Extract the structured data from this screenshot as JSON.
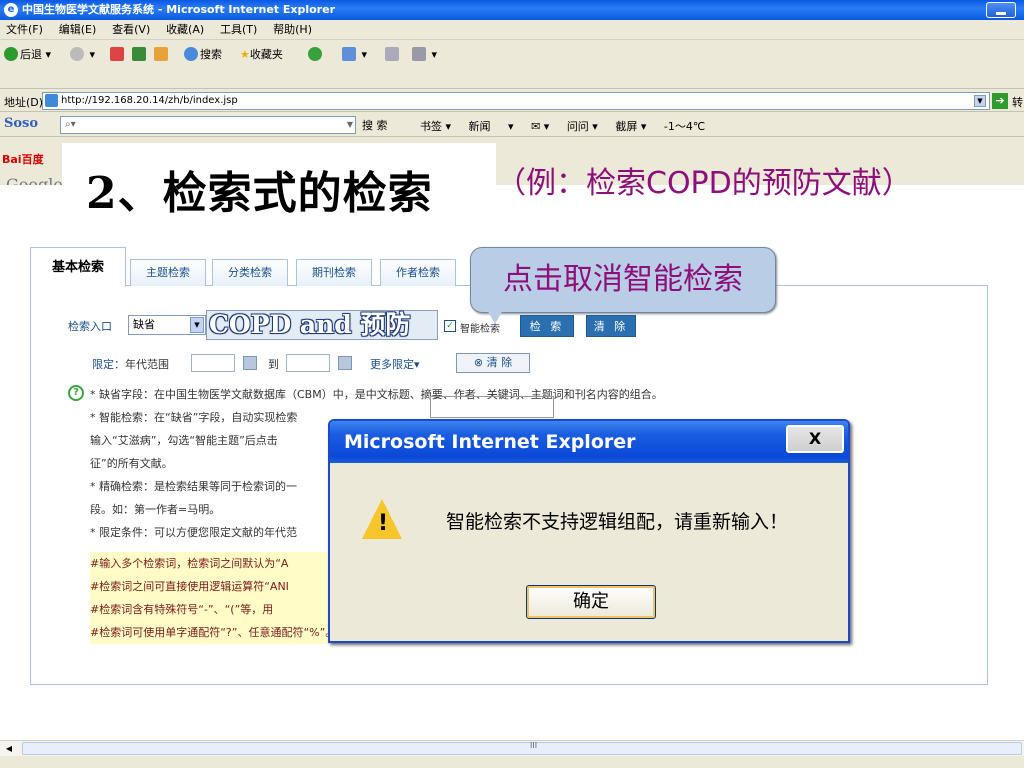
{
  "window": {
    "title": "中国生物医学文献服务系统 - Microsoft Internet Explorer"
  },
  "menu": [
    "文件(F)",
    "编辑(E)",
    "查看(V)",
    "收藏(A)",
    "工具(T)",
    "帮助(H)"
  ],
  "toolbar": {
    "back": "后退",
    "search": "搜索",
    "favorites": "收藏夹"
  },
  "address": {
    "label": "地址(D)",
    "url": "http://192.168.20.14/zh/b/index.jsp",
    "go": "转"
  },
  "soso": {
    "logo": "Soso",
    "search_btn": "搜 索",
    "items": [
      "书签 ▾",
      "新闻",
      "▾",
      "✉ ▾",
      "问问 ▾",
      "截屏 ▾",
      "-1～4℃"
    ]
  },
  "side": {
    "baidu": "Bai百度",
    "google": "Google"
  },
  "slide": {
    "heading": "2、检索式的检索",
    "example": "（例：检索COPD的预防文献）",
    "callout": "点击取消智能检索"
  },
  "tabs": [
    "基本检索",
    "主题检索",
    "分类检索",
    "期刊检索",
    "作者检索"
  ],
  "form": {
    "entry_label": "检索入口",
    "entry_value": "缺省",
    "query": "COPD and 预防",
    "smart_label": "智能检索",
    "smart_checked": "✓",
    "search_btn": "检 索",
    "clear_btn": "清 除",
    "limit_label": "限定：",
    "year_range": "年代范围",
    "to": "到",
    "more_limits": "更多限定▾",
    "clear_limits": "⊗ 清 除"
  },
  "help": {
    "icon": "?",
    "lines": [
      "* 缺省字段：在中国生物医学文献数据库（CBM）中，是中文标题、摘要、作者、关键词、主题词和刊名内容的组合。",
      "* 智能检索：在“缺省”字段，自动实现检索",
      "输入“艾滋病”，勾选“智能主题”后点击",
      "征”的所有文献。",
      "* 精确检索：是检索结果等同于检索词的一",
      "段。如：第一作者=马明。",
      "* 限定条件：可以方便您限定文献的年代范"
    ],
    "tips": [
      "#输入多个检索词，检索词之间默认为“A",
      "#检索词之间可直接使用逻辑运算符“ANI",
      "#检索词含有特殊符号“-”、“(”等，用",
      "#检索词可使用单字通配符“?”、任意通配符“%”。如：胃?癌、肝%疫苗。"
    ]
  },
  "dialog": {
    "title": "Microsoft Internet Explorer",
    "close": "X",
    "message": "智能检索不支持逻辑组配，请重新输入！",
    "ok": "确定"
  },
  "scrollbar": {
    "grip": "III"
  }
}
